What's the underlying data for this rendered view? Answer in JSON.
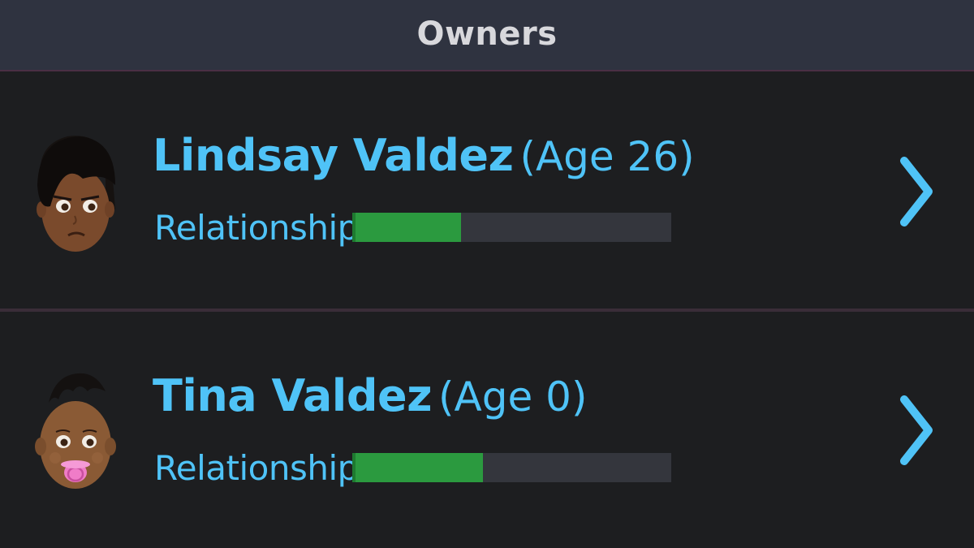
{
  "header": {
    "title": "Owners"
  },
  "owners": [
    {
      "name": "Lindsay Valdez",
      "age_text": "(Age 26)",
      "relationship_label": "Relationship",
      "relationship_level": 0.34,
      "avatar_icon": "adult-woman-avatar-icon"
    },
    {
      "name": "Tina Valdez",
      "age_text": "(Age 0)",
      "relationship_label": "Relationship",
      "relationship_level": 0.41,
      "avatar_icon": "baby-avatar-icon"
    }
  ],
  "colors": {
    "header_bg": "#2f3340",
    "list_bg": "#1d1e20",
    "accent_text": "#4fc3f7",
    "bar_fill": "#2b9a3f",
    "bar_track": "#34363d"
  }
}
